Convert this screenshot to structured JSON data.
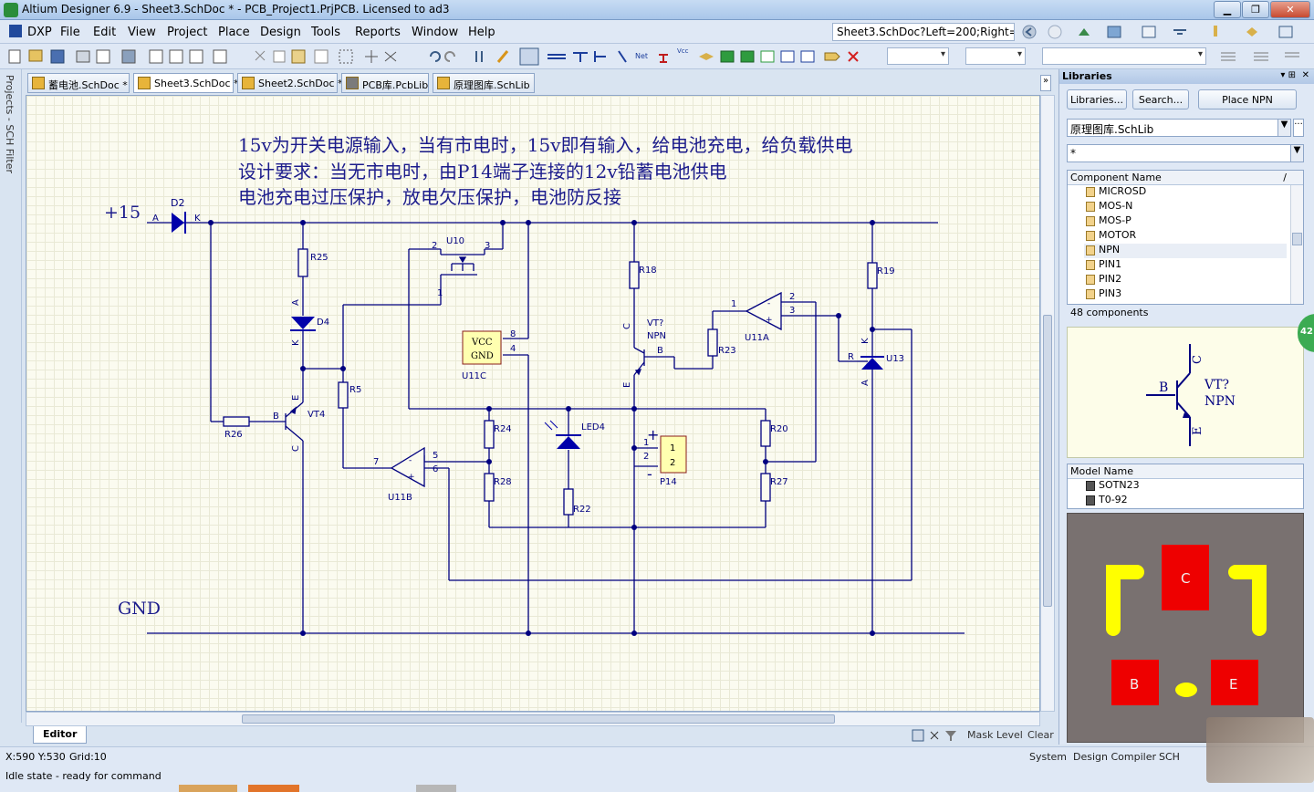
{
  "window": {
    "title": "Altium Designer 6.9 - Sheet3.SchDoc * - PCB_Project1.PrjPCB. Licensed to ad3"
  },
  "menu": {
    "items": [
      "DXP",
      "File",
      "Edit",
      "View",
      "Project",
      "Place",
      "Design",
      "Tools",
      "Reports",
      "Window",
      "Help"
    ],
    "doc_path": "Sheet3.SchDoc?Left=200;Right="
  },
  "left_panel": {
    "label": "Projects - SCH Filter"
  },
  "doc_tabs": [
    {
      "label": "蓄电池.SchDoc *"
    },
    {
      "label": "Sheet3.SchDoc *"
    },
    {
      "label": "Sheet2.SchDoc *"
    },
    {
      "label": "PCB库.PcbLib"
    },
    {
      "label": "原理图库.SchLib"
    }
  ],
  "schematic": {
    "note_line1": "15v为开关电源输入，当有市电时，15v即有输入，给电池充电，给负载供电",
    "note_line2": "设计要求：当无市电时，由P14端子连接的12v铅蓄电池供电",
    "note_line3": "电池充电过压保护，放电欠压保护，电池防反接",
    "net_plus15": "+15",
    "net_gnd": "GND",
    "labels": {
      "D2": "D2",
      "A": "A",
      "K": "K",
      "R25": "R25",
      "D4": "D4",
      "R5": "R5",
      "VT4": "VT4",
      "R26": "R26",
      "B": "B",
      "C": "C",
      "E": "E",
      "U10": "U10",
      "p2": "2",
      "p3": "3",
      "p1": "1",
      "p4": "4",
      "p5": "5",
      "p6": "6",
      "p7": "7",
      "p8": "8",
      "VCC": "VCC",
      "GND_pin": "GND",
      "U11C": "U11C",
      "U11B": "U11B",
      "U11A": "U11A",
      "R24": "R24",
      "R28": "R28",
      "LED4": "LED4",
      "R22": "R22",
      "R18": "R18",
      "VTq": "VT?",
      "NPN": "NPN",
      "R23": "R23",
      "P14": "P14",
      "plus": "+",
      "minus": "-",
      "R20": "R20",
      "R27": "R27",
      "R19": "R19",
      "U13": "U13",
      "R": "R"
    }
  },
  "editor_tab": "Editor",
  "mask_level": "Mask Level",
  "clear": "Clear",
  "status": {
    "coords": "X:590 Y:530",
    "grid": "Grid:10",
    "state": "Idle state - ready for command",
    "tabs": [
      "System",
      "Design Compiler",
      "SCH"
    ]
  },
  "libraries": {
    "title": "Libraries",
    "btn_libraries": "Libraries...",
    "btn_search": "Search...",
    "btn_place": "Place NPN",
    "current_lib": "原理图库.SchLib",
    "filter": "*",
    "col_component": "Component Name",
    "components": [
      "MICROSD",
      "MOS-N",
      "MOS-P",
      "MOTOR",
      "NPN",
      "PIN1",
      "PIN2",
      "PIN3"
    ],
    "selected": "NPN",
    "count": "48 components",
    "preview": {
      "C": "C",
      "B": "B",
      "E": "E",
      "ref": "VT?",
      "name": "NPN"
    },
    "col_model": "Model Name",
    "models": [
      "SOTN23",
      "T0-92"
    ],
    "pcb_pads": {
      "C": "C",
      "B": "B",
      "E": "E"
    },
    "badge": "42"
  },
  "colors": {
    "wire": "#000080",
    "component": "#0000aa",
    "sheet_bg": "#fbfbf0",
    "pad_red": "#ee0000",
    "silk_yellow": "#ffff00"
  }
}
